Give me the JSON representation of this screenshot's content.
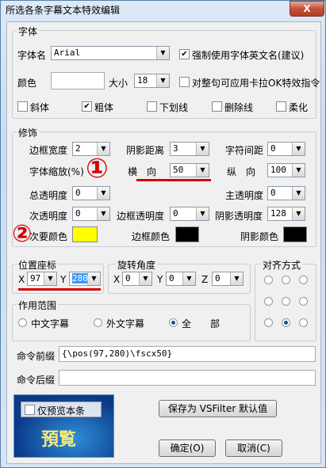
{
  "window": {
    "title": "所选各条字幕文本特效编辑",
    "close": "X"
  },
  "font_group": {
    "label": "字体",
    "font_name_label": "字体名",
    "font_name": "Arial",
    "force_english_name": "强制使用字体英文名(建议)",
    "color_label": "颜色",
    "size_label": "大小",
    "size": "18",
    "apply_karaoke": "对整句可应用卡拉OK特效指令",
    "italic": "斜体",
    "bold": "粗体",
    "underline": "下划线",
    "strikeout": "删除线",
    "soft": "柔化"
  },
  "effects_group": {
    "label": "修饰",
    "border_width_label": "边框宽度",
    "border_width": "2",
    "shadow_distance_label": "阴影距离",
    "shadow_distance": "3",
    "char_spacing_label": "字符间距",
    "char_spacing": "0",
    "scale_label": "字体缩放(%)",
    "scale_x_label": "横　向",
    "scale_x": "50",
    "scale_y_label": "纵　向",
    "scale_y": "100",
    "total_alpha_label": "总透明度",
    "total_alpha": "0",
    "primary_alpha_label": "主透明度",
    "primary_alpha": "0",
    "secondary_alpha_label": "次透明度",
    "secondary_alpha": "0",
    "border_alpha_label": "边框透明度",
    "border_alpha": "0",
    "shadow_alpha_label": "阴影透明度",
    "shadow_alpha": "128",
    "secondary_color_label": "次要颜色",
    "border_color_label": "边框颜色",
    "shadow_color_label": "阴影颜色",
    "colors": {
      "secondary": "#ffff00",
      "border": "#000000",
      "shadow": "#000000",
      "primary": "#ffffff"
    }
  },
  "position_group": {
    "label": "位置座标",
    "x_label": "X",
    "x": "97",
    "y_label": "Y",
    "y": "280"
  },
  "rotation_group": {
    "label": "旋转角度",
    "x_label": "X",
    "x": "0",
    "y_label": "Y",
    "y": "0",
    "z_label": "Z",
    "z": "0"
  },
  "align_group": {
    "label": "对齐方式",
    "selected": "bottom-center"
  },
  "scope_group": {
    "label": "作用范围",
    "options": [
      "中文字幕",
      "外文字幕",
      "全　　部"
    ],
    "selected": "全　　部"
  },
  "command_prefix": {
    "label": "命令前缀",
    "value": "{\\pos(97,280)\\fscx50}"
  },
  "command_suffix": {
    "label": "命令后缀",
    "value": ""
  },
  "preview": {
    "checkbox": "仅预览本条",
    "logo": "預覧"
  },
  "buttons": {
    "save_default": "保存为 VSFilter 默认值",
    "ok": "确定(O)",
    "cancel": "取消(C)"
  },
  "annotations": {
    "one": "①",
    "two": "②"
  }
}
